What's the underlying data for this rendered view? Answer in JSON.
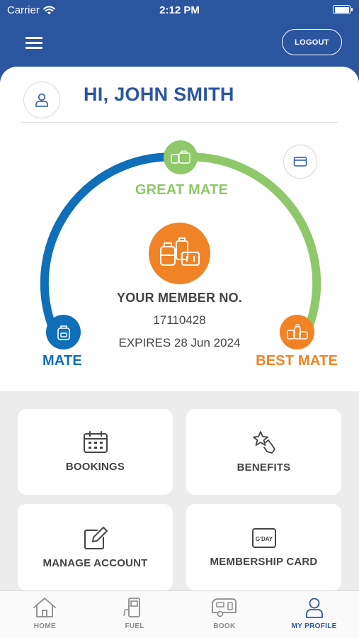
{
  "status_bar": {
    "carrier": "Carrier",
    "time": "2:12 PM"
  },
  "header": {
    "logout_label": "LOGOUT"
  },
  "profile": {
    "greeting": "HI, JOHN SMITH"
  },
  "membership": {
    "tiers": {
      "great": "GREAT MATE",
      "mate": "MATE",
      "best": "BEST MATE"
    },
    "heading": "YOUR MEMBER NO.",
    "number": "17110428",
    "expires": "EXPIRES 28 Jun 2024"
  },
  "tiles": {
    "bookings": "BOOKINGS",
    "benefits": "BENEFITS",
    "manage_account": "MANAGE ACCOUNT",
    "membership_card": "MEMBERSHIP CARD",
    "gday_icon_text": "G'DAY"
  },
  "tabbar": {
    "home": "HOME",
    "fuel": "FUEL",
    "book": "BOOK",
    "my_profile": "MY PROFILE"
  },
  "colors": {
    "brand_blue": "#2c55a0",
    "mate_blue": "#0f6fb8",
    "great_green": "#8ec86a",
    "best_orange": "#f08325"
  }
}
